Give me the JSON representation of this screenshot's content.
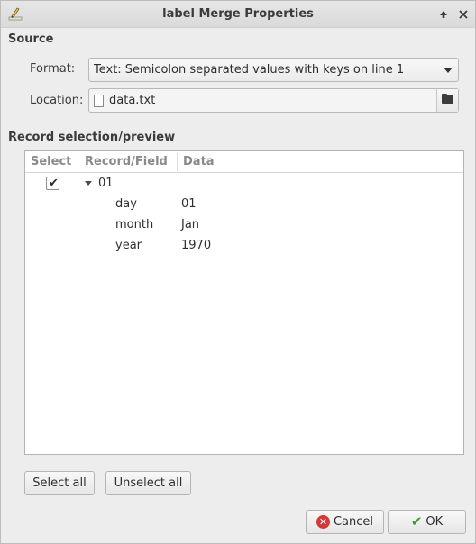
{
  "window": {
    "title": "label Merge Properties"
  },
  "source": {
    "heading": "Source",
    "format_label": "Format:",
    "format_value": "Text: Semicolon separated values with keys on line 1",
    "location_label": "Location:",
    "location_value": "data.txt"
  },
  "records": {
    "heading": "Record selection/preview",
    "columns": [
      "Select",
      "Record/Field",
      "Data"
    ],
    "record": {
      "name": "01",
      "checked": true,
      "fields": [
        {
          "field": "day",
          "data": "01"
        },
        {
          "field": "month",
          "data": "Jan"
        },
        {
          "field": "year",
          "data": "1970"
        }
      ]
    }
  },
  "buttons": {
    "select_all": "Select all",
    "unselect_all": "Unselect all",
    "cancel": "Cancel",
    "ok": "OK"
  },
  "icons": {
    "app": "label-edit-icon",
    "up": "arrow-up-icon",
    "close": "close-icon",
    "folder": "folder-icon",
    "cancel": "cancel-icon",
    "ok": "checkmark-icon"
  },
  "colors": {
    "cancel_icon": "#d23a3a",
    "ok_icon": "#3e9a2e"
  }
}
